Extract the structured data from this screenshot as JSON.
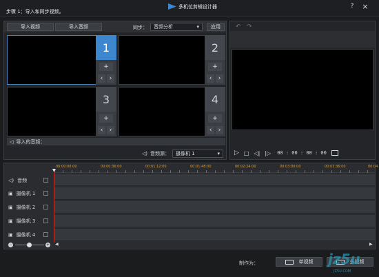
{
  "window": {
    "title": "多机位剪辑设计器",
    "step": "步骤 1：导入和同步视频。",
    "help": "?",
    "close": "×"
  },
  "toolbar": {
    "import_video": "导入视频",
    "import_audio": "导入音频",
    "sync_label": "同步：",
    "sync_value": "音频分析",
    "apply": "应用"
  },
  "cameras": [
    {
      "number": "1",
      "active": true
    },
    {
      "number": "2",
      "active": false
    },
    {
      "number": "3",
      "active": false
    },
    {
      "number": "4",
      "active": false
    }
  ],
  "imported_audio_label": "导入的音频：",
  "audio_source": {
    "label": "音频源：",
    "value": "摄像机 1"
  },
  "preview": {
    "timecode": "00 : 00 : 00 : 00"
  },
  "timeline": {
    "ruler": [
      "00:00:00:00",
      "00:00:36:00",
      "00:01:12:00",
      "00:01:48:00",
      "00:02:24:00",
      "00:03:00:00",
      "00:03:36:00",
      "00:04"
    ],
    "tracks": [
      {
        "label": "音频",
        "icon": "speaker-icon"
      },
      {
        "label": "摄像机 1",
        "icon": "camera-icon"
      },
      {
        "label": "摄像机 2",
        "icon": "camera-icon"
      },
      {
        "label": "摄像机 3",
        "icon": "camera-icon"
      },
      {
        "label": "摄像机 4",
        "icon": "camera-icon"
      }
    ]
  },
  "footer": {
    "make_label": "制作为：",
    "single_video": "单视频",
    "multi_video": "多视频",
    "watermark_big": "jz5u",
    "watermark_small": "JZ5U.COM"
  },
  "colors": {
    "accent": "#3d87cf",
    "playhead": "#c4302b",
    "ruler_text": "#d79a3b",
    "watermark": "#2a8fa8"
  }
}
